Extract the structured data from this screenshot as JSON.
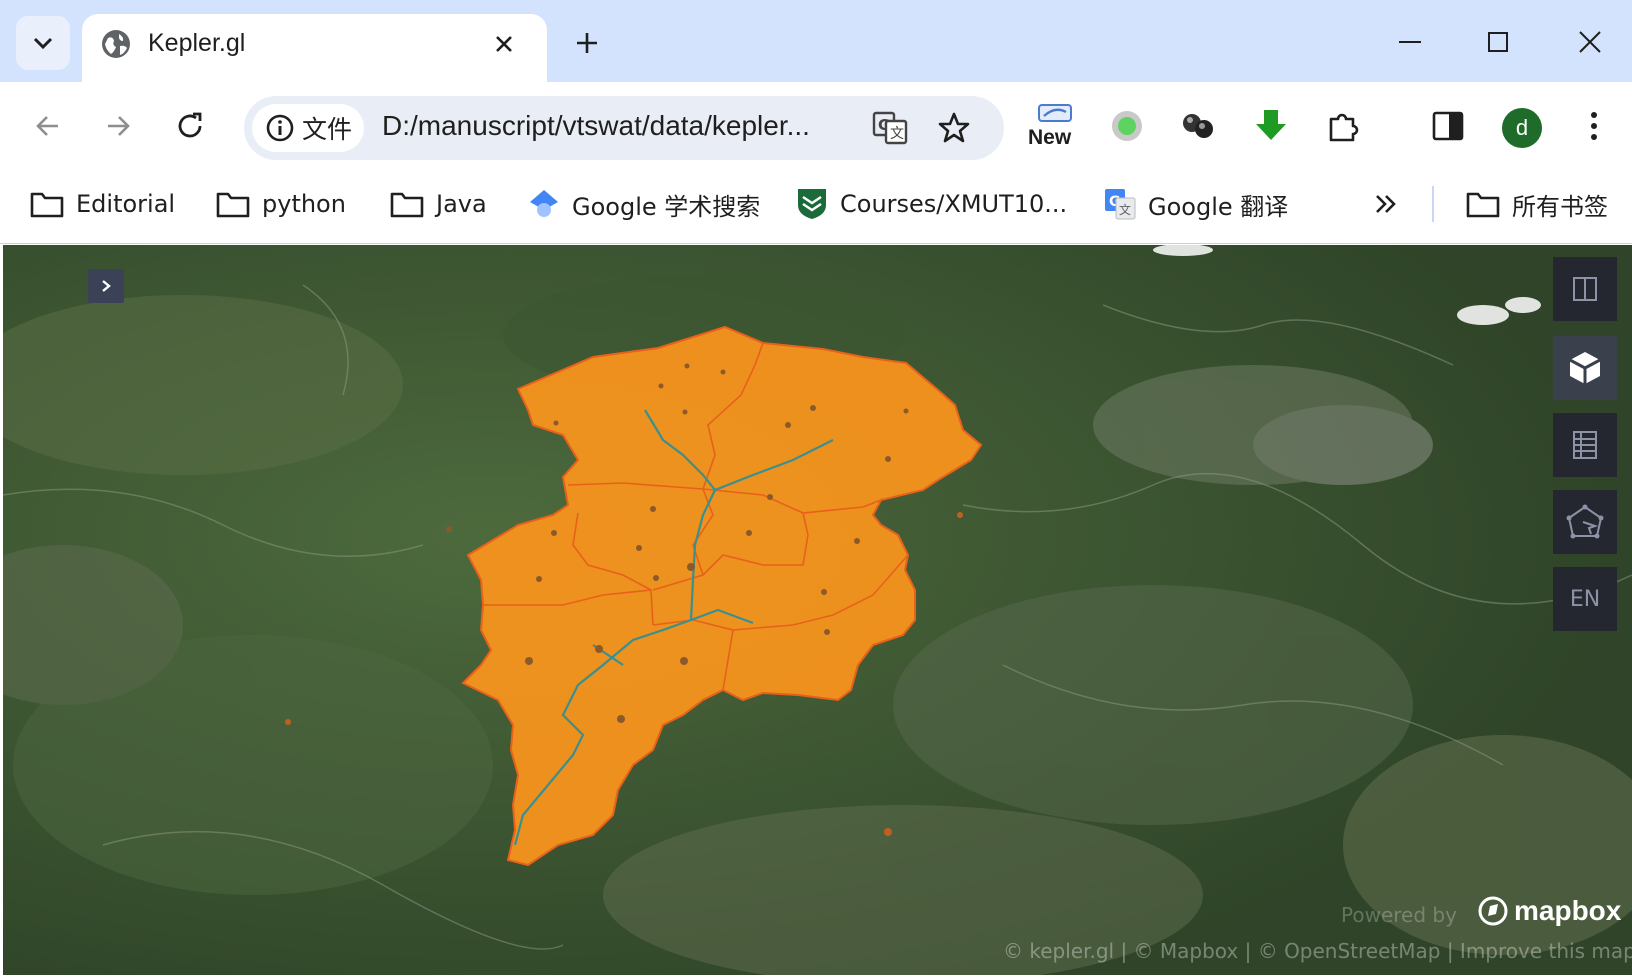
{
  "browser": {
    "tab": {
      "title": "Kepler.gl"
    },
    "address": {
      "site_chip": "文件",
      "url": "D:/manuscript/vtswat/data/kepler..."
    },
    "extensions": {
      "new_badge": "New"
    },
    "profile": {
      "initial": "d"
    }
  },
  "bookmarks": [
    {
      "label": "Editorial",
      "icon": "folder-icon"
    },
    {
      "label": "python",
      "icon": "folder-icon"
    },
    {
      "label": "Java",
      "icon": "folder-icon"
    },
    {
      "label": "Google 学术搜索",
      "icon": "google-scholar-icon"
    },
    {
      "label": "Courses/XMUT10...",
      "icon": "course-shield-icon"
    },
    {
      "label": "Google 翻译",
      "icon": "google-translate-icon"
    }
  ],
  "all_bookmarks": "所有书签",
  "map": {
    "lang_button": "EN",
    "mapbox_logo": "mapbox",
    "powered_by": "Powered by",
    "attribution": "© kepler.gl | © Mapbox | © OpenStreetMap | Improve this map",
    "colors": {
      "watershed_fill": "#f7931e",
      "watershed_edge": "#e8611a",
      "river": "#3a8f8f",
      "outlet_point": "#8a5a2b"
    }
  }
}
